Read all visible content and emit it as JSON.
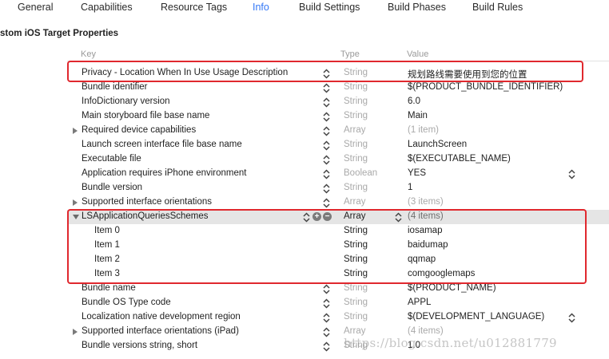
{
  "tabs": [
    {
      "label": "General"
    },
    {
      "label": "Capabilities"
    },
    {
      "label": "Resource Tags"
    },
    {
      "label": "Info",
      "active": true
    },
    {
      "label": "Build Settings"
    },
    {
      "label": "Build Phases"
    },
    {
      "label": "Build Rules"
    }
  ],
  "section_title": "ustom iOS Target Properties",
  "columns": {
    "key": "Key",
    "type": "Type",
    "value": "Value"
  },
  "rows": [
    {
      "key": "Privacy - Location When In Use Usage Description",
      "type": "String",
      "value": "规划路线需要使用到您的位置"
    },
    {
      "key": "Bundle identifier",
      "type": "String",
      "value": "$(PRODUCT_BUNDLE_IDENTIFIER)"
    },
    {
      "key": "InfoDictionary version",
      "type": "String",
      "value": "6.0"
    },
    {
      "key": "Main storyboard file base name",
      "type": "String",
      "value": "Main"
    },
    {
      "key": "Required device capabilities",
      "type": "Array",
      "value": "(1 item)"
    },
    {
      "key": "Launch screen interface file base name",
      "type": "String",
      "value": "LaunchScreen"
    },
    {
      "key": "Executable file",
      "type": "String",
      "value": "$(EXECUTABLE_NAME)"
    },
    {
      "key": "Application requires iPhone environment",
      "type": "Boolean",
      "value": "YES"
    },
    {
      "key": "Bundle version",
      "type": "String",
      "value": "1"
    },
    {
      "key": "Supported interface orientations",
      "type": "Array",
      "value": "(3 items)"
    },
    {
      "key": "LSApplicationQueriesSchemes",
      "type": "Array",
      "value": "(4 items)"
    },
    {
      "key": "Item 0",
      "type": "String",
      "value": "iosamap"
    },
    {
      "key": "Item 1",
      "type": "String",
      "value": "baidumap"
    },
    {
      "key": "Item 2",
      "type": "String",
      "value": "qqmap"
    },
    {
      "key": "Item 3",
      "type": "String",
      "value": "comgooglemaps"
    },
    {
      "key": "Bundle name",
      "type": "String",
      "value": "$(PRODUCT_NAME)"
    },
    {
      "key": "Bundle OS Type code",
      "type": "String",
      "value": "APPL"
    },
    {
      "key": "Localization native development region",
      "type": "String",
      "value": "$(DEVELOPMENT_LANGUAGE)"
    },
    {
      "key": "Supported interface orientations (iPad)",
      "type": "Array",
      "value": "(4 items)"
    },
    {
      "key": "Bundle versions string, short",
      "type": "String",
      "value": "1.0"
    }
  ],
  "watermark": "https://blog.csdn.net/u012881779",
  "colors": {
    "accent": "#3478f6",
    "highlight": "#e0282e",
    "group_row": "#e5e5e5"
  }
}
